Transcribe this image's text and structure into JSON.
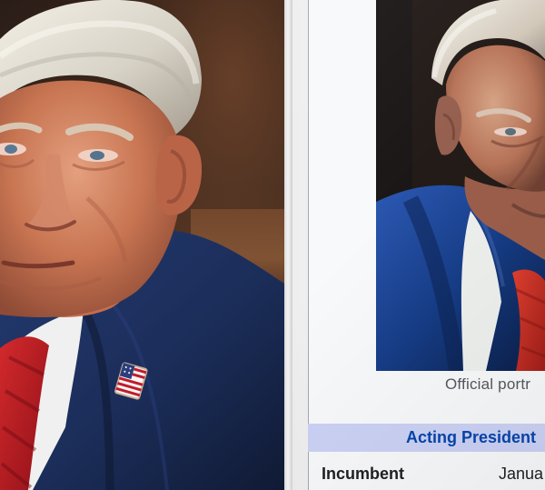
{
  "left_panel": {
    "image_name": "official-meeting-portrait",
    "flag_pin": "american-flag-pin"
  },
  "right_panel": {
    "portrait_caption": "Official portr",
    "office_header": "Acting President",
    "incumbent_label": "Incumbent",
    "incumbent_date": "Janua"
  },
  "colors": {
    "suit": "#1d2f5d",
    "tie": "#b2151e",
    "infobox_header": "#ccd2f5",
    "link_blue": "#0645ad"
  }
}
